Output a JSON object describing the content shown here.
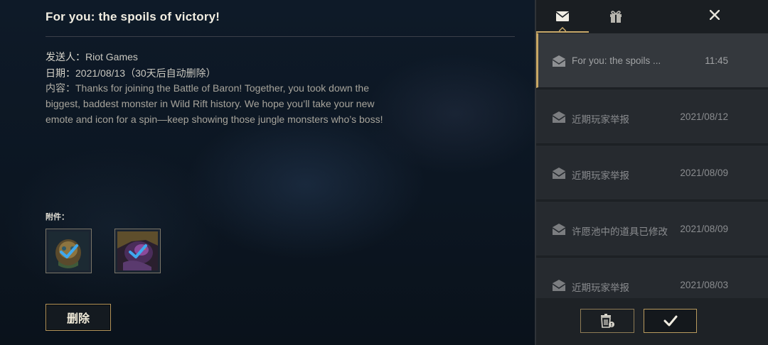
{
  "mail_detail": {
    "title": "For you: the spoils of victory!",
    "sender_label": "发送人：",
    "sender": "Riot Games",
    "date_label": "日期：",
    "date": "2021/08/13（30天后自动删除）",
    "content_label": "内容：",
    "content": "Thanks for joining the Battle of Baron! Together, you took down the biggest, baddest monster in Wild Rift history. We hope you’ll take your new emote and icon for a spin—keep showing those jungle monsters who’s boss!",
    "attachments_label": "附件：",
    "attachments": [
      {
        "name": "emote",
        "claimed": true
      },
      {
        "name": "icon",
        "claimed": true
      }
    ],
    "delete_label": "删除"
  },
  "panel": {
    "tabs": [
      {
        "icon": "mail-icon",
        "active": true
      },
      {
        "icon": "gift-icon",
        "active": false
      }
    ],
    "mails": [
      {
        "subject": "For you: the spoils ...",
        "time": "11:45",
        "selected": true
      },
      {
        "subject": "近期玩家举报",
        "time": "2021/08/12",
        "selected": false
      },
      {
        "subject": "近期玩家举报",
        "time": "2021/08/09",
        "selected": false
      },
      {
        "subject": "许愿池中的道具已修改",
        "time": "2021/08/09",
        "selected": false
      },
      {
        "subject": "近期玩家举报",
        "time": "2021/08/03",
        "selected": false
      }
    ]
  },
  "colors": {
    "accent_gold": "#c8a96a",
    "panel_bg": "#1e2226",
    "check_blue": "#3fa9ef"
  }
}
